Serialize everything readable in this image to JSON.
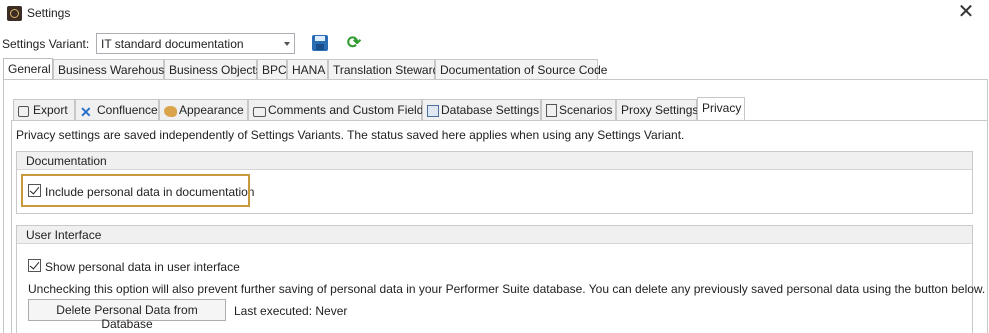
{
  "window": {
    "title": "Settings",
    "close_glyph": "✕"
  },
  "variant": {
    "label": "Settings Variant:",
    "value": "IT standard documentation",
    "save_icon": "save-icon",
    "refresh_icon": "refresh-icon"
  },
  "top_tabs": [
    "General",
    "Business Warehouse",
    "Business Objects",
    "BPC",
    "HANA",
    "Translation Steward",
    "Documentation of Source Code"
  ],
  "inner_tabs": [
    "Export",
    "Confluence",
    "Appearance",
    "Comments and Custom Fields",
    "Database Settings",
    "Scenarios",
    "Proxy Settings",
    "Privacy"
  ],
  "privacy": {
    "note": "Privacy settings are saved independently of Settings Variants. The status saved here applies when using any Settings Variant.",
    "documentation": {
      "header": "Documentation",
      "checkbox_label": "Include personal data in documentation",
      "checked": true
    },
    "user_interface": {
      "header": "User Interface",
      "checkbox_label": "Show personal data in user interface",
      "checked": true,
      "info": "Unchecking this option will also prevent further saving of personal data in your Performer Suite database. You can delete any previously saved personal data using the button below.",
      "delete_button": "Delete Personal Data from Database",
      "last_executed": "Last executed: Never"
    }
  },
  "colors": {
    "highlight": "#c9993e",
    "group_header_bg": "#f0f0f0"
  }
}
